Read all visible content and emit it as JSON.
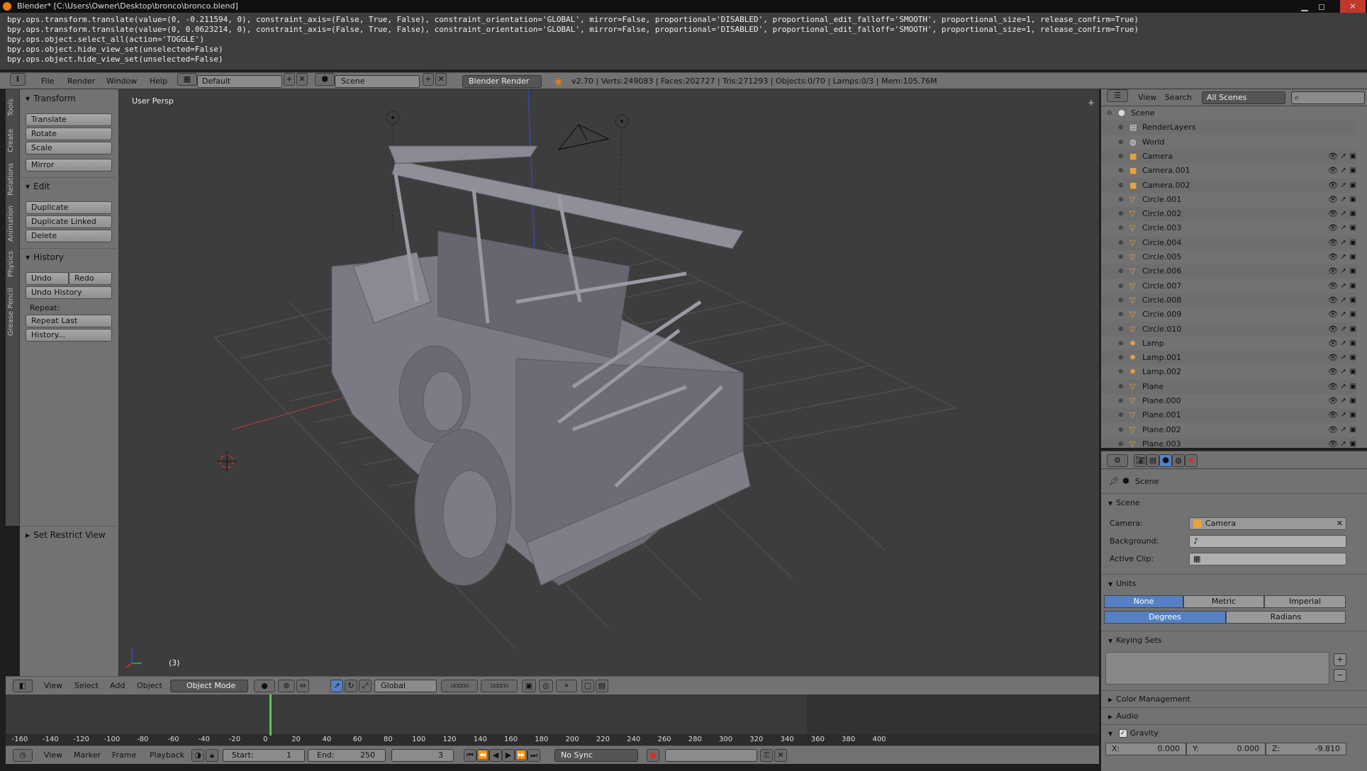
{
  "window": {
    "title": "Blender* [C:\\Users\\Owner\\Desktop\\bronco\\bronco.blend]",
    "controls": [
      "▁",
      "◻",
      "✕"
    ]
  },
  "info_log": [
    "bpy.ops.transform.translate(value=(0, -0.211594, 0), constraint_axis=(False, True, False), constraint_orientation='GLOBAL', mirror=False, proportional='DISABLED', proportional_edit_falloff='SMOOTH', proportional_size=1, release_confirm=True)",
    "bpy.ops.transform.translate(value=(0, 0.0623214, 0), constraint_axis=(False, True, False), constraint_orientation='GLOBAL', mirror=False, proportional='DISABLED', proportional_edit_falloff='SMOOTH', proportional_size=1, release_confirm=True)",
    "bpy.ops.object.select_all(action='TOGGLE')",
    "bpy.ops.object.hide_view_set(unselected=False)",
    "bpy.ops.object.hide_view_set(unselected=False)"
  ],
  "infobar": {
    "menus": [
      "File",
      "Render",
      "Window",
      "Help"
    ],
    "screen_layout": "Default",
    "scene": "Scene",
    "render_engine": "Blender Render",
    "stats": "v2.70 | Verts:249083 | Faces:202727 | Tris:271293 | Objects:0/70 | Lamps:0/3 | Mem:105.76M"
  },
  "tool_tabs": [
    "Tools",
    "Create",
    "Relations",
    "Animation",
    "Physics",
    "Grease Pencil"
  ],
  "tools": {
    "transform_title": "Transform",
    "translate": "Translate",
    "rotate": "Rotate",
    "scale": "Scale",
    "mirror": "Mirror",
    "edit_title": "Edit",
    "duplicate": "Duplicate",
    "duplicate_linked": "Duplicate Linked",
    "delete": "Delete",
    "history_title": "History",
    "undo": "Undo",
    "redo": "Redo",
    "undo_history": "Undo History",
    "repeat_label": "Repeat:",
    "repeat_last": "Repeat Last",
    "history": "History...",
    "set_restrict_view": "Set Restrict View"
  },
  "viewport": {
    "label": "User Persp",
    "frame_indicator": "(3)"
  },
  "viewport_header": {
    "menus": [
      "View",
      "Select",
      "Add",
      "Object"
    ],
    "mode": "Object Mode",
    "orientation": "Global"
  },
  "timeline": {
    "ticks": [
      "-160",
      "-140",
      "-120",
      "-100",
      "-80",
      "-60",
      "-40",
      "-20",
      "0",
      "20",
      "40",
      "60",
      "80",
      "100",
      "120",
      "140",
      "160",
      "180",
      "200",
      "220",
      "240",
      "260",
      "280",
      "300",
      "320",
      "340",
      "360",
      "380",
      "400"
    ],
    "current_frame": 3,
    "menus": [
      "View",
      "Marker",
      "Frame",
      "Playback"
    ],
    "start_label": "Start:",
    "start": "1",
    "end_label": "End:",
    "end": "250",
    "frame": "3",
    "sync": "No Sync"
  },
  "outliner": {
    "menus": [
      "View",
      "Search"
    ],
    "filter": "All Scenes",
    "rows": [
      {
        "name": "Scene",
        "type": "scene",
        "indent": 0,
        "vis": false
      },
      {
        "name": "RenderLayers",
        "type": "renderlayer",
        "indent": 1,
        "vis": false
      },
      {
        "name": "World",
        "type": "world",
        "indent": 1,
        "vis": false
      },
      {
        "name": "Camera",
        "type": "camera",
        "indent": 1,
        "vis": true
      },
      {
        "name": "Camera.001",
        "type": "camera",
        "indent": 1,
        "vis": true
      },
      {
        "name": "Camera.002",
        "type": "camera",
        "indent": 1,
        "vis": true
      },
      {
        "name": "Circle.001",
        "type": "mesh",
        "indent": 1,
        "vis": true
      },
      {
        "name": "Circle.002",
        "type": "mesh",
        "indent": 1,
        "vis": true
      },
      {
        "name": "Circle.003",
        "type": "mesh",
        "indent": 1,
        "vis": true
      },
      {
        "name": "Circle.004",
        "type": "mesh",
        "indent": 1,
        "vis": true
      },
      {
        "name": "Circle.005",
        "type": "mesh",
        "indent": 1,
        "vis": true
      },
      {
        "name": "Circle.006",
        "type": "mesh",
        "indent": 1,
        "vis": true
      },
      {
        "name": "Circle.007",
        "type": "mesh",
        "indent": 1,
        "vis": true
      },
      {
        "name": "Circle.008",
        "type": "mesh",
        "indent": 1,
        "vis": true
      },
      {
        "name": "Circle.009",
        "type": "mesh",
        "indent": 1,
        "vis": true
      },
      {
        "name": "Circle.010",
        "type": "mesh",
        "indent": 1,
        "vis": true
      },
      {
        "name": "Lamp",
        "type": "lamp",
        "indent": 1,
        "vis": true
      },
      {
        "name": "Lamp.001",
        "type": "lamp",
        "indent": 1,
        "vis": true
      },
      {
        "name": "Lamp.002",
        "type": "lamp",
        "indent": 1,
        "vis": true
      },
      {
        "name": "Plane",
        "type": "mesh",
        "indent": 1,
        "vis": true
      },
      {
        "name": "Plane.000",
        "type": "mesh",
        "indent": 1,
        "vis": true
      },
      {
        "name": "Plane.001",
        "type": "mesh",
        "indent": 1,
        "vis": true
      },
      {
        "name": "Plane.002",
        "type": "mesh",
        "indent": 1,
        "vis": true
      },
      {
        "name": "Plane.003",
        "type": "mesh",
        "indent": 1,
        "vis": true
      }
    ]
  },
  "properties": {
    "breadcrumb": "Scene",
    "scene_section": "Scene",
    "camera_label": "Camera:",
    "camera_value": "Camera",
    "background_label": "Background:",
    "active_clip_label": "Active Clip:",
    "units_section": "Units",
    "units": [
      "None",
      "Metric",
      "Imperial"
    ],
    "units_selected": "None",
    "angle": [
      "Degrees",
      "Radians"
    ],
    "angle_selected": "Degrees",
    "keying_sets_section": "Keying Sets",
    "color_management": "Color Management",
    "audio": "Audio",
    "gravity": "Gravity",
    "gravity_x": "X:",
    "gravity_x_val": "0.000",
    "gravity_y": "Y:",
    "gravity_y_val": "0.000",
    "gravity_z": "Z:",
    "gravity_z_val": "-9.810"
  },
  "colors": {
    "accent_blue": "#5680c2",
    "panel_gray": "#727272",
    "viewport_bg": "#3d3d3d",
    "object_orange": "#e8a33c",
    "timeline_green": "#5fc15f"
  }
}
